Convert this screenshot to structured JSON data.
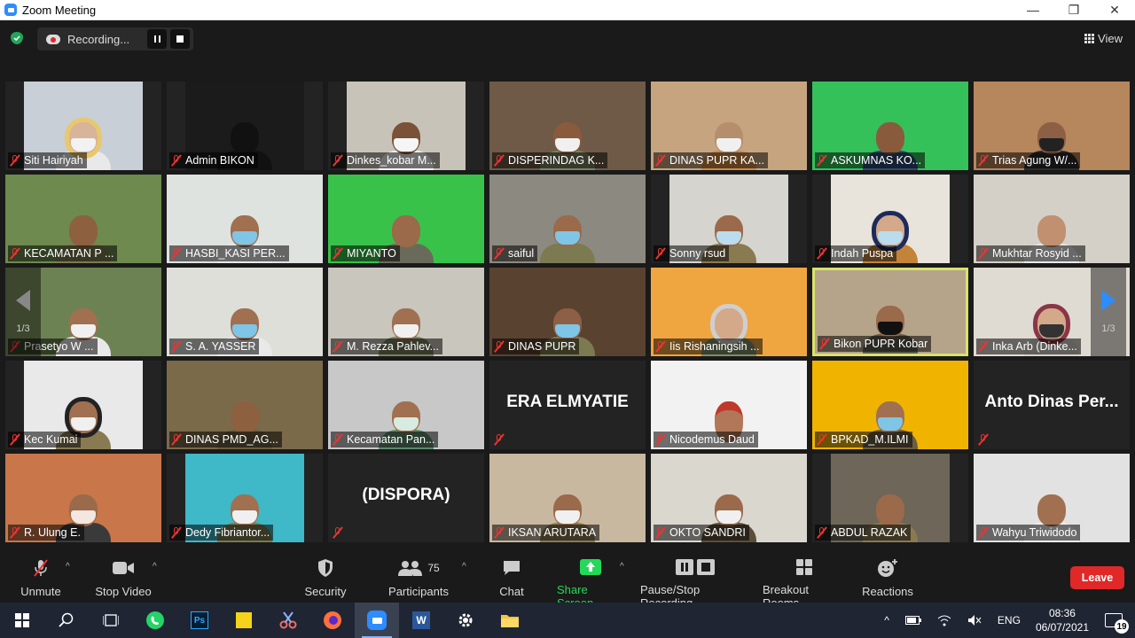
{
  "window": {
    "title": "Zoom Meeting"
  },
  "top": {
    "recording_label": "Recording...",
    "view_label": "View"
  },
  "tiles": [
    {
      "name": "Siti Hairiyah",
      "skin": "#d8b49a",
      "bg": "#c9cfd6",
      "mask": "#f2f2f2",
      "body": "#e9e9e9",
      "hijab": "#e8c86a"
    },
    {
      "name": "Admin BIKON",
      "skin": "#111",
      "bg": "#1b1b1b",
      "mask": "#111",
      "body": "#111"
    },
    {
      "name": "Dinkes_kobar M...",
      "skin": "#7a5238",
      "bg": "#c8c3b8",
      "mask": "#f5f5f5",
      "body": "#f3f3f3"
    },
    {
      "name": "DISPERINDAG K...",
      "skin": "#8a5a3c",
      "bg": "#6e5a46",
      "mask": "#f0f0f0",
      "body": "#7b8261"
    },
    {
      "name": "DINAS PUPR KA...",
      "skin": "#b58e6e",
      "bg": "#c7a480",
      "mask": "#f0f0f0",
      "body": "#cc8a45"
    },
    {
      "name": "ASKUMNAS KO...",
      "skin": "#8a5a3c",
      "bg": "#34c15a",
      "mask": "#8a5a3c",
      "body": "#2e4a72"
    },
    {
      "name": "Trias Agung W/...",
      "skin": "#8d5f44",
      "bg": "#b6865c",
      "mask": "#222",
      "body": "#2b2b2b"
    },
    {
      "name": "KECAMATAN P ...",
      "skin": "#8d6040",
      "bg": "#6e8a4e",
      "mask": "#8d6040",
      "body": "#7b7a50"
    },
    {
      "name": "HASBI_KASI PER...",
      "skin": "#a07050",
      "bg": "#dfe3e0",
      "mask": "#7fc5e6",
      "body": "#e9e9e9"
    },
    {
      "name": "MIYANTO",
      "skin": "#9a6a4a",
      "bg": "#38c24a",
      "mask": "#9a6a4a",
      "body": "#6a6a5a"
    },
    {
      "name": "saiful",
      "skin": "#9a6a4a",
      "bg": "#8c8a80",
      "mask": "#7fc5e6",
      "body": "#7b7a50"
    },
    {
      "name": "Sonny rsud",
      "skin": "#9a6a4a",
      "bg": "#d6d4cf",
      "mask": "#b9dcef",
      "body": "#8a7a52"
    },
    {
      "name": "Indah Puspa",
      "skin": "#d3a98a",
      "bg": "#e8e4dc",
      "mask": "#b9dcef",
      "body": "#c3843a",
      "hijab": "#1c2b5a"
    },
    {
      "name": "Mukhtar Rosyid ...",
      "skin": "#c09070",
      "bg": "#d4d0c8",
      "mask": "#c09070",
      "body": "#e9e9e9"
    },
    {
      "name": "Prasetyo W ...",
      "skin": "#a07050",
      "bg": "#6d8252",
      "mask": "#f0f0f0",
      "body": "#e9e9e9"
    },
    {
      "name": "S. A. YASSER",
      "skin": "#a07050",
      "bg": "#dedfd9",
      "mask": "#7fc5e6",
      "body": "#e9e9e9"
    },
    {
      "name": "M. Rezza Pahlev...",
      "skin": "#a07050",
      "bg": "#c9c6bd",
      "mask": "#f0f0f0",
      "body": "#7b8261"
    },
    {
      "name": "DINAS PUPR",
      "skin": "#8d5f44",
      "bg": "#5a4230",
      "mask": "#7fc5e6",
      "body": "#7b7a50"
    },
    {
      "name": "Iis Rishaningsih ...",
      "skin": "#d3a98a",
      "bg": "#f0a640",
      "mask": "#d3a98a",
      "body": "#7e8e6a",
      "hijab": "#cfcfcf"
    },
    {
      "name": "Bikon PUPR Kobar",
      "skin": "#9a6a4a",
      "bg": "#b6a48a",
      "mask": "#111",
      "body": "#5c5a4c"
    },
    {
      "name": "Inka Arb (Dinke...",
      "skin": "#d3a98a",
      "bg": "#e0dbd2",
      "mask": "#333",
      "body": "#d7d2c9",
      "hijab": "#8a3548"
    },
    {
      "name": "Kec Kumai",
      "skin": "#a07050",
      "bg": "#e9e9e9",
      "mask": "#f0f0f0",
      "body": "#8a7a52",
      "hijab": "#222"
    },
    {
      "name": "DINAS PMD_AG...",
      "skin": "#8d6040",
      "bg": "#7a6a4a",
      "mask": "#8d6040",
      "body": "#6a5e3e"
    },
    {
      "name": "Kecamatan Pan...",
      "skin": "#a07050",
      "bg": "#c8c8c8",
      "mask": "#d7ebe0",
      "body": "#5c8a6a"
    },
    {
      "name": "",
      "big": "ERA ELMYATIE"
    },
    {
      "name": "Nicodemus Daud",
      "skin": "#b07858",
      "bg": "#f2f2f2",
      "mask": "#b07858",
      "body": "#f2f2f2",
      "hat": "#c0392b"
    },
    {
      "name": "BPKAD_M.ILMI",
      "skin": "#a07050",
      "bg": "#f0b400",
      "mask": "#7fc5e6",
      "body": "#6a5e3e"
    },
    {
      "name": "",
      "big": "Anto Dinas Per..."
    },
    {
      "name": "R. Ulung E.",
      "skin": "#9a6a4a",
      "bg": "#c8764a",
      "mask": "#f3e7e0",
      "body": "#3a3a3a"
    },
    {
      "name": "Dedy Fibriantor...",
      "skin": "#a07050",
      "bg": "#3fb8c8",
      "mask": "#f0f0f0",
      "body": "#7b7a50"
    },
    {
      "name": "",
      "big": "(DISPORA)"
    },
    {
      "name": "IKSAN ARUTARA",
      "skin": "#9a6a4a",
      "bg": "#c8b8a0",
      "mask": "#f0f0f0",
      "body": "#8a7a52"
    },
    {
      "name": "OKTO SANDRI",
      "skin": "#9a6a4a",
      "bg": "#dad7cf",
      "mask": "#f0f0f0",
      "body": "#5c4f3a"
    },
    {
      "name": "ABDUL RAZAK",
      "skin": "#9a6a4a",
      "bg": "#6e6658",
      "mask": "#9a6a4a",
      "body": "#8a7a52"
    },
    {
      "name": "Wahyu Triwidodo",
      "skin": "#a07050",
      "bg": "#e2e2e2",
      "mask": "#a07050",
      "body": "#f2f2f2"
    }
  ],
  "pagination": {
    "left": "1/3",
    "right": "1/3"
  },
  "toolbar": {
    "unmute": "Unmute",
    "stop_video": "Stop Video",
    "security": "Security",
    "participants": "Participants",
    "participant_count": "75",
    "chat": "Chat",
    "share_screen": "Share Screen",
    "pause_recording": "Pause/Stop Recording",
    "breakout_rooms": "Breakout Rooms",
    "reactions": "Reactions",
    "leave": "Leave"
  },
  "taskbar": {
    "apps": [
      "start-icon",
      "search-icon",
      "task-view-icon",
      "whatsapp-icon",
      "photoshop-icon",
      "sticky-notes-icon",
      "snipping-tool-icon",
      "firefox-icon",
      "zoom-icon",
      "word-icon",
      "settings-icon",
      "file-explorer-icon"
    ],
    "language": "ENG",
    "time": "08:36",
    "date": "06/07/2021",
    "notifications": "19"
  },
  "colors": {
    "accent": "#2d8cff",
    "leave": "#e02828",
    "share_green": "#23d959",
    "active_speaker": "#d8e36a",
    "muted_red": "#e33333"
  }
}
